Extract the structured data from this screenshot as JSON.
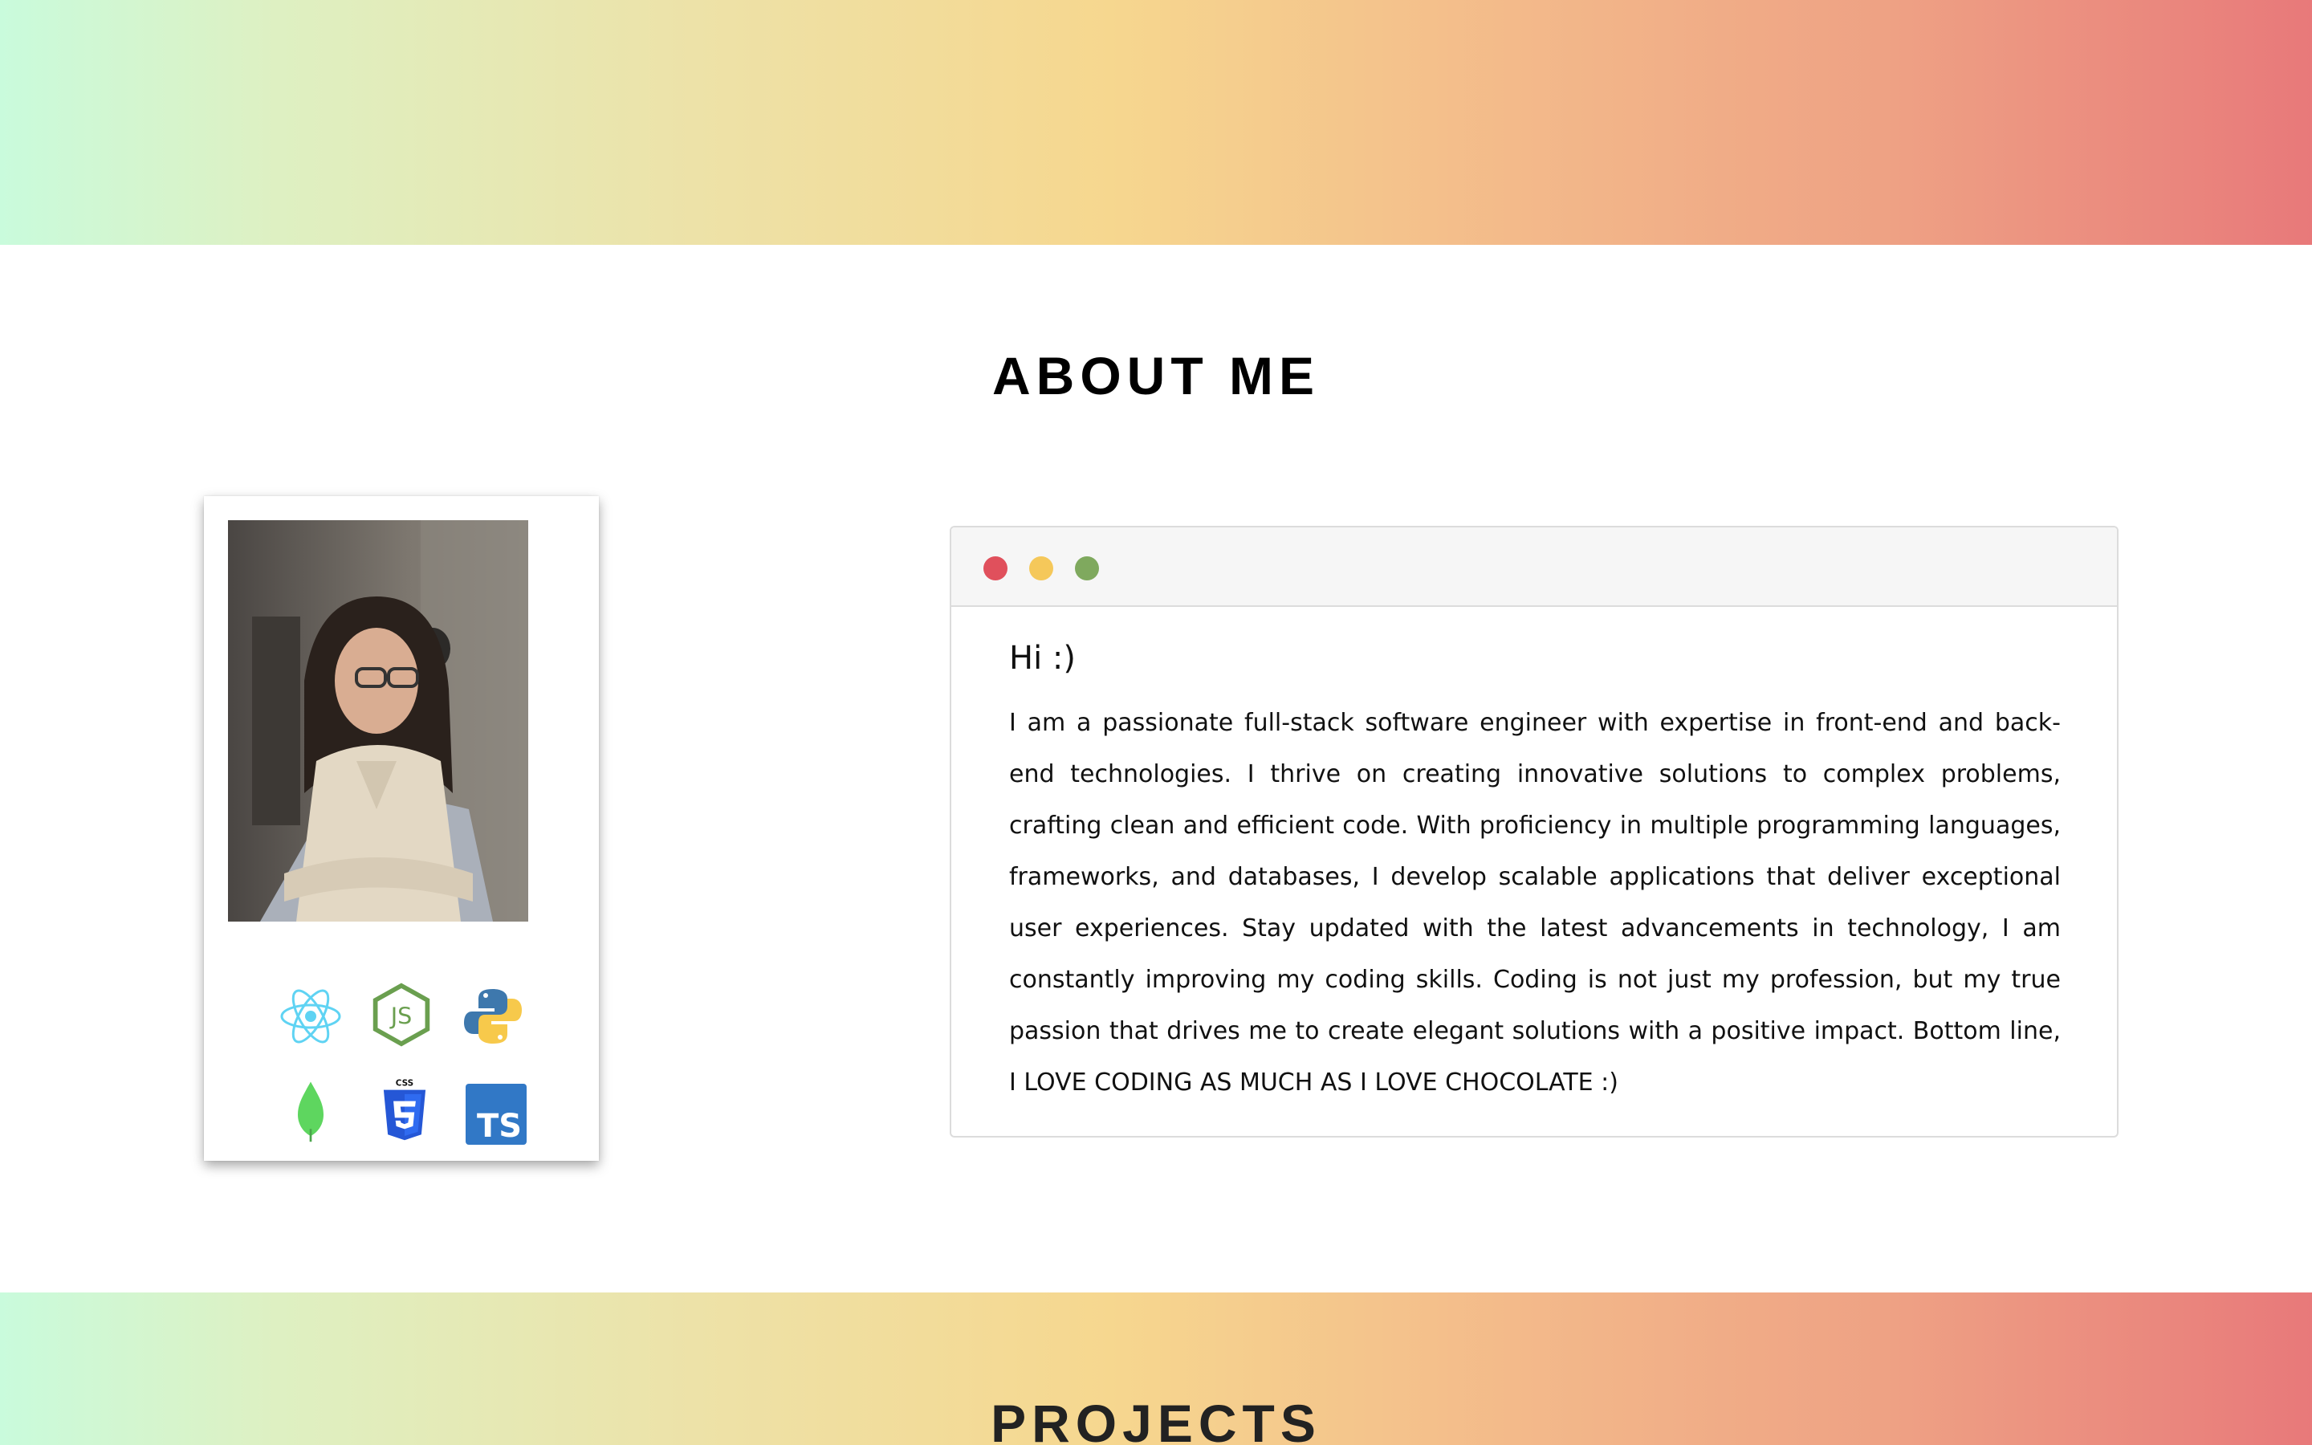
{
  "sections": {
    "about_title": "ABOUT ME",
    "projects_title": "PROJECTS"
  },
  "colors": {
    "gradient": [
      "#c9fbdc",
      "#ede2a8",
      "#f6d78f",
      "#f3b98a",
      "#e8797a"
    ],
    "window_dot_red": "#e0505c",
    "window_dot_yellow": "#f5c85a",
    "window_dot_green": "#7fa95e"
  },
  "profile_card": {
    "photo_alt": "profile-photo",
    "tech_icons": [
      "react-icon",
      "nodejs-icon",
      "python-icon",
      "mongodb-icon",
      "css3-icon",
      "typescript-icon"
    ]
  },
  "about_window": {
    "greeting": "Hi :)",
    "bio": "I am a passionate full-stack software engineer with expertise in front-end and back-end technologies. I thrive on creating innovative solutions to complex problems, crafting clean and efficient code. With proficiency in multiple programming languages, frameworks, and databases, I develop scalable applications that deliver exceptional user experiences. Stay updated with the latest advancements in technology, I am constantly improving my coding skills. Coding is not just my profession, but my true passion that drives me to create elegant solutions with a positive impact. Bottom line, I LOVE CODING AS MUCH AS I LOVE CHOCOLATE :)"
  },
  "tech_labels": {
    "node": "JS",
    "css": "CSS",
    "ts": "TS"
  }
}
